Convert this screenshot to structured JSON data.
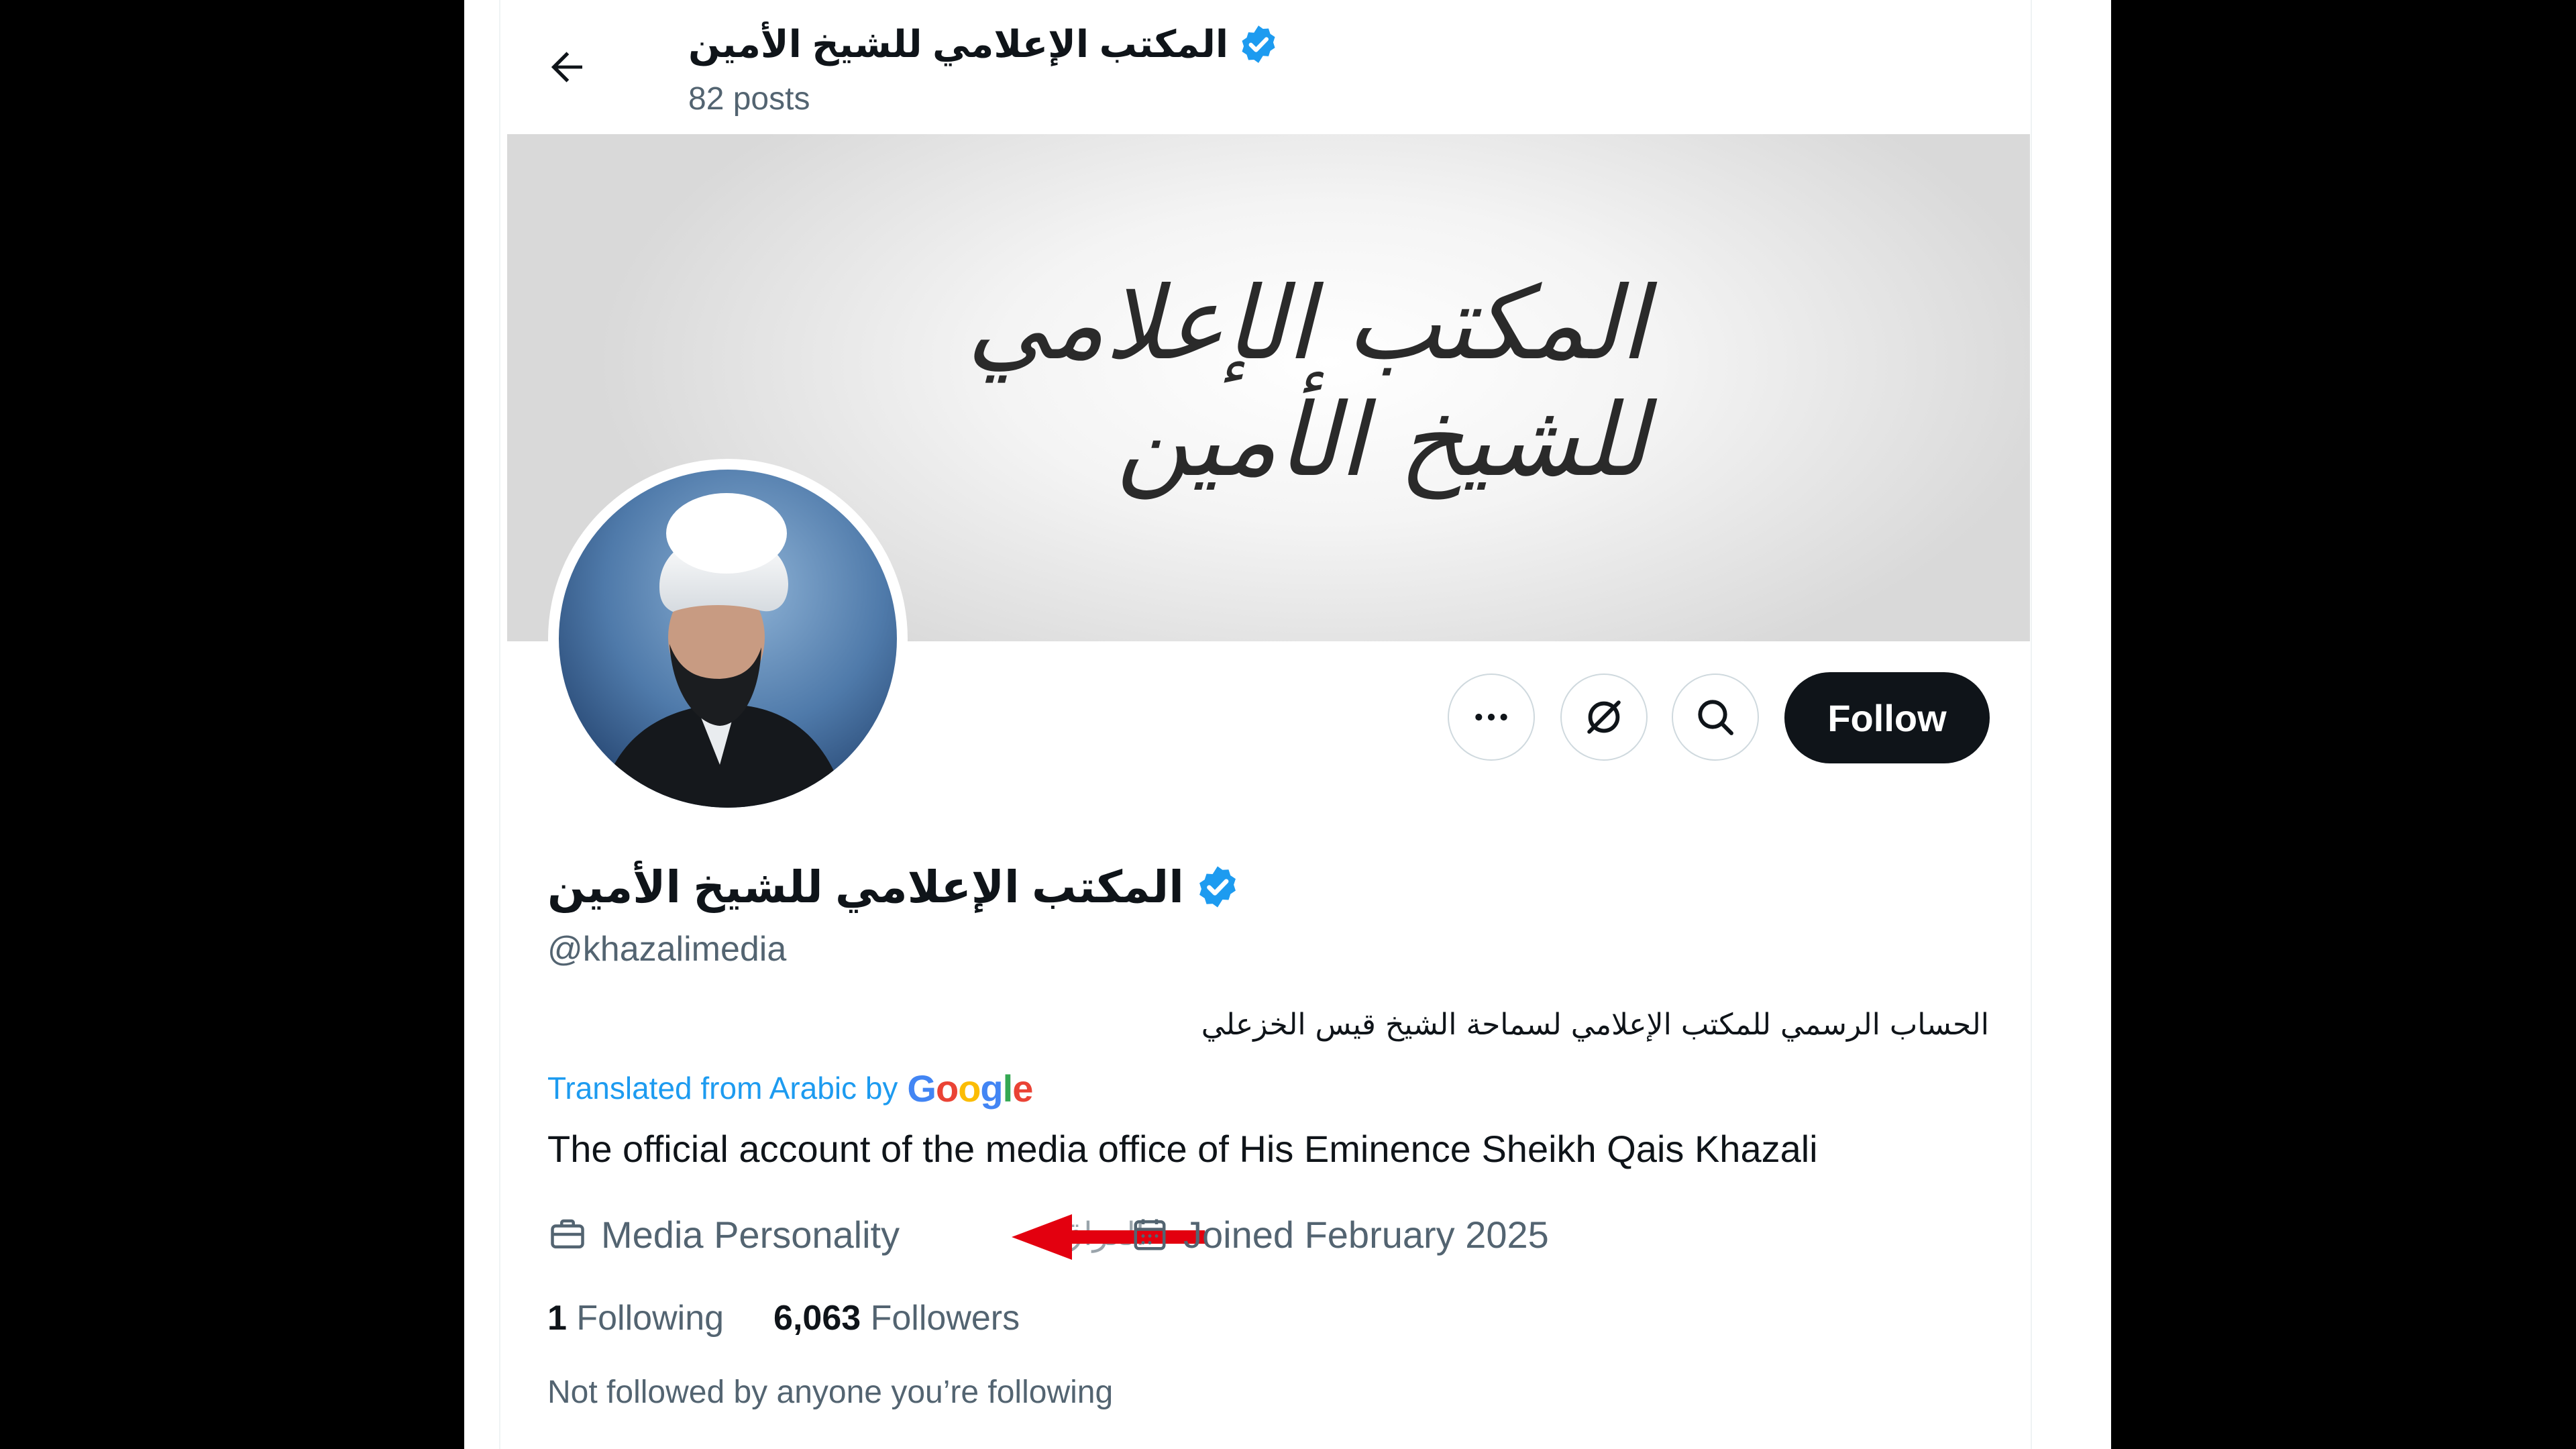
{
  "header": {
    "title": "المكتب الإعلامي للشيخ الأمين",
    "posts_count": "82 posts"
  },
  "banner": {
    "calligraphy_text": "المكتب الإعلامي للشيخ الأمين"
  },
  "actions": {
    "more_icon": "more-horizontal-icon",
    "grok_icon": "slashed-circle-icon",
    "search_icon": "search-icon",
    "follow_label": "Follow"
  },
  "profile": {
    "display_name": "المكتب الإعلامي للشيخ الأمين",
    "handle": "@khazalimedia",
    "bio_arabic": "الحساب الرسمي للمكتب الإعلامي لسماحة الشيخ قيس الخزعلي",
    "translated_prefix": "Translated from Arabic by",
    "translator_letters": [
      "G",
      "o",
      "o",
      "g",
      "l",
      "e"
    ],
    "bio_english": "The official account of the media office of His Eminence Sheikh Qais Khazali",
    "category": "Media Personality",
    "location_partial": "العراق",
    "joined": "Joined February 2025",
    "following_count": "1",
    "following_label": "Following",
    "followers_count": "6,063",
    "followers_label": "Followers",
    "not_followed_text": "Not followed by anyone you’re following"
  },
  "colors": {
    "verified": "#1d9bf0",
    "annotation_arrow": "#e3000f",
    "text_primary": "#0f1419",
    "text_secondary": "#536471"
  }
}
